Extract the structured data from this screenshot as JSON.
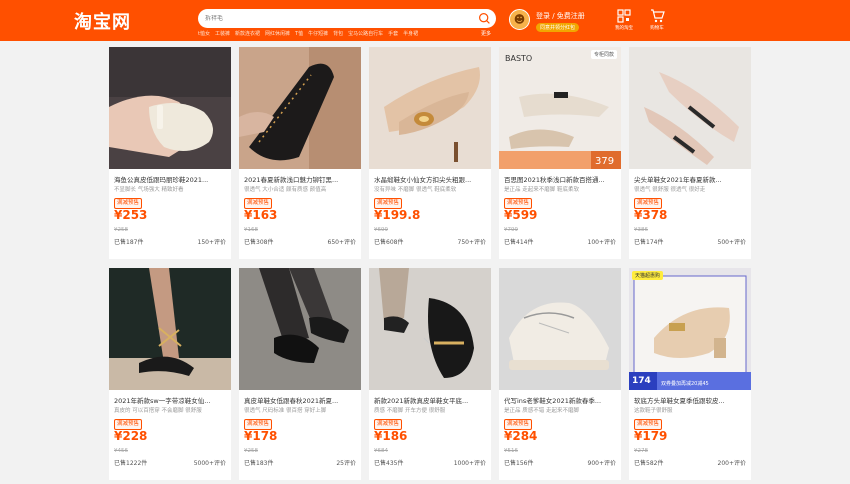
{
  "header": {
    "logo": "淘宝网",
    "search_placeholder": "拆袢毛",
    "hotwords": [
      "t恤女",
      "工装裤",
      "新款连衣裙",
      "网红休闲裤",
      "T恤",
      "牛仔短裤",
      "背包",
      "宝马公路自行车",
      "手套",
      "半身裙"
    ],
    "hotwords_more": "更多",
    "login": "登录 / 免费注册",
    "login_sub": "同意并领分红包",
    "nav": [
      {
        "label": "我的淘宝",
        "icon": "qr-icon"
      },
      {
        "label": "购物车",
        "icon": "cart-icon"
      }
    ]
  },
  "products": [
    {
      "title": "海鱼公真皮低跟玛丽珍鞋2021...",
      "tags": "不显脚长 气场强大 精致好看",
      "promo": "满减预售",
      "price": "¥253",
      "orig": "¥258",
      "sold": "已售187件",
      "reviews": "150+评价",
      "badge": ""
    },
    {
      "title": "2021春夏新款浅口魅力铆钉黑...",
      "tags": "很透气 大小合适 颇有质感 颜值高",
      "promo": "满减预售",
      "price": "¥163",
      "orig": "¥168",
      "sold": "已售308件",
      "reviews": "650+评价",
      "badge": ""
    },
    {
      "title": "水晶缎鞋女小仙女方扣尖头粗跟...",
      "tags": "没有异味 不磨脚 很透气 鞋底柔软",
      "promo": "满减预售",
      "price": "¥199.8",
      "orig": "¥699",
      "sold": "已售608件",
      "reviews": "750+评价",
      "badge": ""
    },
    {
      "title": "百思图2021秋季浅口新款百搭通...",
      "tags": "是正品 走起来不磨脚 鞋底柔软",
      "promo": "满减预售",
      "price": "¥599",
      "orig": "¥799",
      "sold": "已售414件",
      "reviews": "100+评价",
      "badge": "专柜同款"
    },
    {
      "title": "尖头单鞋女2021年春夏新款...",
      "tags": "很透气 很舒服 很透气 很好走",
      "promo": "满减预售",
      "price": "¥378",
      "orig": "¥386",
      "sold": "已售174件",
      "reviews": "500+评价",
      "badge": ""
    },
    {
      "title": "2021年新款sw一字带凉鞋女仙...",
      "tags": "真皮的 可以百搭穿 不会磨脚 很舒服",
      "promo": "满减预售",
      "price": "¥228",
      "orig": "¥456",
      "sold": "已售1222件",
      "reviews": "5000+评价",
      "badge": ""
    },
    {
      "title": "真皮单鞋女低跟春秋2021新夏...",
      "tags": "很透气 尺码标准 很百搭 穿好上脚",
      "promo": "满减预售",
      "price": "¥178",
      "orig": "¥258",
      "sold": "已售183件",
      "reviews": "25评价",
      "badge": ""
    },
    {
      "title": "新款2021新款真皮单鞋女平底...",
      "tags": "质感 不磨脚 开车方便 很舒服",
      "promo": "满减预售",
      "price": "¥186",
      "orig": "¥684",
      "sold": "已售435件",
      "reviews": "1000+评价",
      "badge": ""
    },
    {
      "title": "代写ins老爹鞋女2021新款春季...",
      "tags": "是正品 质感不错 走起来不磨脚",
      "promo": "满减预售",
      "price": "¥284",
      "orig": "¥516",
      "sold": "已售156件",
      "reviews": "900+评价",
      "badge": ""
    },
    {
      "title": "软底方头单鞋女夏季低跟软皮...",
      "tags": "这款鞋子很舒服",
      "promo": "满减预售",
      "price": "¥179",
      "orig": "¥278",
      "sold": "已售582件",
      "reviews": "200+评价",
      "badge": "天猫超惠购",
      "overlay_price": "174",
      "overlay_text": "双券叠加再减20减45"
    }
  ]
}
